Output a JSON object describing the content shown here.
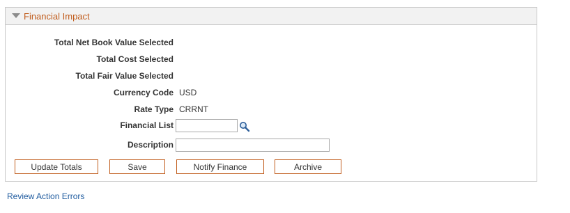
{
  "panel": {
    "title": "Financial Impact"
  },
  "fields": {
    "total_net_book_value_label": "Total Net Book Value Selected",
    "total_cost_label": "Total Cost Selected",
    "total_fair_value_label": "Total Fair Value Selected",
    "currency_code_label": "Currency Code",
    "currency_code_value": "USD",
    "rate_type_label": "Rate Type",
    "rate_type_value": "CRRNT",
    "financial_list_label": "Financial List",
    "financial_list_value": "",
    "description_label": "Description",
    "description_value": ""
  },
  "buttons": {
    "update_totals": "Update Totals",
    "save": "Save",
    "notify_finance": "Notify Finance",
    "archive": "Archive"
  },
  "links": {
    "review_action_errors": "Review Action Errors"
  },
  "icons": {
    "collapse": "triangle-down-icon",
    "lookup": "magnifying-glass-icon"
  },
  "colors": {
    "title": "#c15d1d",
    "button_border": "#c15d1d",
    "link": "#1f5b9f",
    "header_bg": "#f2f2f2"
  }
}
